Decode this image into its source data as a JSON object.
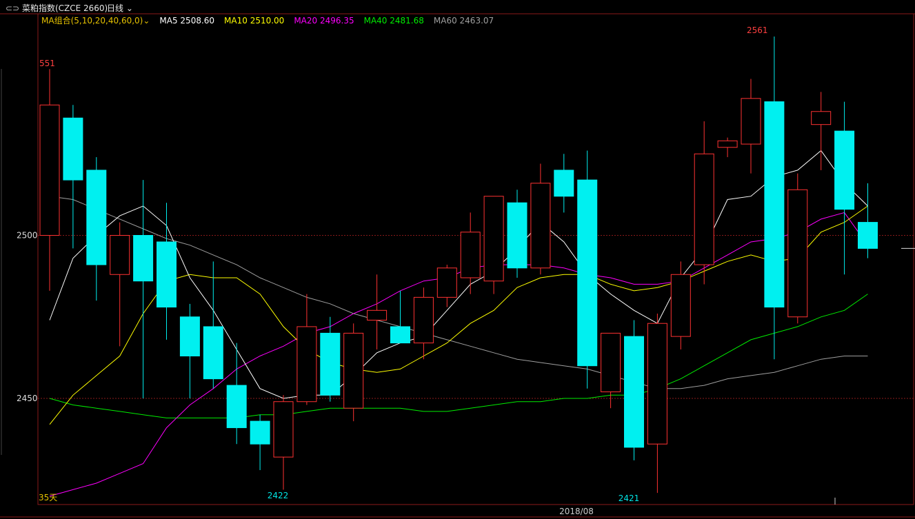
{
  "header": {
    "instrument": "菜粕指数(CZCE 2660)",
    "period": "日线"
  },
  "ma_legend": [
    {
      "label": "MA组合(5,10,20,40,60,0)",
      "color": "#e6c200",
      "has_chevron": true
    },
    {
      "label": "MA5 2508.60",
      "color": "#ffffff"
    },
    {
      "label": "MA10 2510.00",
      "color": "#ffff00"
    },
    {
      "label": "MA20 2496.35",
      "color": "#ff00ff"
    },
    {
      "label": "MA40 2481.68",
      "color": "#00ee00"
    },
    {
      "label": "MA60 2463.07",
      "color": "#a0a0a0"
    }
  ],
  "chart_data": {
    "type": "candlestick",
    "y_ticks": [
      2450,
      2500
    ],
    "y_tick_labels": [
      "2450",
      "2500"
    ],
    "ylim": [
      2418,
      2568
    ],
    "x_label": "2018/08",
    "annotations": {
      "high": "2561",
      "low_left": "2422",
      "low_right": "2421",
      "top_left": "551",
      "bottom_left": "35天"
    },
    "colors": {
      "up": "#ff3232",
      "down": "#00f0f0",
      "grid": "#8b1a1a"
    },
    "candles": [
      {
        "o": 2500,
        "h": 2551,
        "l": 2483,
        "c": 2540
      },
      {
        "o": 2536,
        "h": 2540,
        "l": 2496,
        "c": 2517
      },
      {
        "o": 2520,
        "h": 2524,
        "l": 2480,
        "c": 2491
      },
      {
        "o": 2488,
        "h": 2504,
        "l": 2466,
        "c": 2500
      },
      {
        "o": 2500,
        "h": 2517,
        "l": 2450,
        "c": 2486
      },
      {
        "o": 2498,
        "h": 2510,
        "l": 2468,
        "c": 2478
      },
      {
        "o": 2475,
        "h": 2479,
        "l": 2450,
        "c": 2463
      },
      {
        "o": 2472,
        "h": 2492,
        "l": 2453,
        "c": 2456
      },
      {
        "o": 2454,
        "h": 2467,
        "l": 2436,
        "c": 2441
      },
      {
        "o": 2443,
        "h": 2445,
        "l": 2428,
        "c": 2436
      },
      {
        "o": 2432,
        "h": 2451,
        "l": 2422,
        "c": 2449
      },
      {
        "o": 2449,
        "h": 2482,
        "l": 2448,
        "c": 2472
      },
      {
        "o": 2470,
        "h": 2475,
        "l": 2449,
        "c": 2451
      },
      {
        "o": 2447,
        "h": 2473,
        "l": 2443,
        "c": 2470
      },
      {
        "o": 2474,
        "h": 2488,
        "l": 2465,
        "c": 2477
      },
      {
        "o": 2472,
        "h": 2483,
        "l": 2468,
        "c": 2467
      },
      {
        "o": 2467,
        "h": 2484,
        "l": 2462,
        "c": 2481
      },
      {
        "o": 2481,
        "h": 2491,
        "l": 2478,
        "c": 2490
      },
      {
        "o": 2487,
        "h": 2507,
        "l": 2482,
        "c": 2501
      },
      {
        "o": 2486,
        "h": 2510,
        "l": 2482,
        "c": 2512
      },
      {
        "o": 2510,
        "h": 2514,
        "l": 2487,
        "c": 2490
      },
      {
        "o": 2490,
        "h": 2522,
        "l": 2488,
        "c": 2516
      },
      {
        "o": 2520,
        "h": 2525,
        "l": 2507,
        "c": 2512
      },
      {
        "o": 2517,
        "h": 2526,
        "l": 2453,
        "c": 2460
      },
      {
        "o": 2452,
        "h": 2465,
        "l": 2447,
        "c": 2470
      },
      {
        "o": 2469,
        "h": 2474,
        "l": 2431,
        "c": 2435
      },
      {
        "o": 2436,
        "h": 2476,
        "l": 2421,
        "c": 2473
      },
      {
        "o": 2469,
        "h": 2492,
        "l": 2465,
        "c": 2488
      },
      {
        "o": 2491,
        "h": 2535,
        "l": 2485,
        "c": 2525
      },
      {
        "o": 2527,
        "h": 2530,
        "l": 2524,
        "c": 2529
      },
      {
        "o": 2528,
        "h": 2548,
        "l": 2519,
        "c": 2542
      },
      {
        "o": 2541,
        "h": 2561,
        "l": 2462,
        "c": 2478
      },
      {
        "o": 2475,
        "h": 2519,
        "l": 2473,
        "c": 2514
      },
      {
        "o": 2534,
        "h": 2544,
        "l": 2520,
        "c": 2538
      },
      {
        "o": 2532,
        "h": 2541,
        "l": 2488,
        "c": 2508
      },
      {
        "o": 2504,
        "h": 2516,
        "l": 2493,
        "c": 2496
      }
    ],
    "ma5": [
      2474,
      2493,
      2500,
      2506,
      2509,
      2503,
      2487,
      2477,
      2465,
      2453,
      2450,
      2451,
      2451,
      2457,
      2464,
      2467,
      2469,
      2477,
      2485,
      2489,
      2496,
      2504,
      2498,
      2488,
      2482,
      2477,
      2473,
      2487,
      2496,
      2511,
      2512,
      2518,
      2520,
      2526,
      2516,
      2509
    ],
    "ma10": [
      2442,
      2451,
      2457,
      2463,
      2476,
      2486,
      2488,
      2487,
      2487,
      2482,
      2472,
      2465,
      2461,
      2459,
      2458,
      2459,
      2463,
      2467,
      2473,
      2477,
      2484,
      2487,
      2488,
      2488,
      2485,
      2483,
      2484,
      2486,
      2489,
      2492,
      2494,
      2492,
      2493,
      2501,
      2504,
      2509
    ],
    "ma20": [
      2420,
      2422,
      2424,
      2427,
      2430,
      2441,
      2448,
      2453,
      2459,
      2463,
      2466,
      2470,
      2472,
      2476,
      2479,
      2483,
      2486,
      2487,
      2490,
      2491,
      2491,
      2491,
      2490,
      2488,
      2487,
      2485,
      2485,
      2486,
      2490,
      2494,
      2498,
      2499,
      2501,
      2505,
      2507,
      2497
    ],
    "ma40": [
      2450,
      2448,
      2447,
      2446,
      2445,
      2444,
      2444,
      2444,
      2444,
      2445,
      2445,
      2446,
      2447,
      2447,
      2447,
      2447,
      2446,
      2446,
      2447,
      2448,
      2449,
      2449,
      2450,
      2450,
      2451,
      2451,
      2453,
      2456,
      2460,
      2464,
      2468,
      2470,
      2472,
      2475,
      2477,
      2482
    ],
    "ma60": [
      2512,
      2511,
      2508,
      2505,
      2502,
      2499,
      2497,
      2494,
      2491,
      2487,
      2484,
      2481,
      2479,
      2476,
      2474,
      2472,
      2470,
      2468,
      2466,
      2464,
      2462,
      2461,
      2460,
      2459,
      2457,
      2455,
      2453,
      2453,
      2454,
      2456,
      2457,
      2458,
      2460,
      2462,
      2463,
      2463
    ],
    "last_price_marker": 2496
  }
}
